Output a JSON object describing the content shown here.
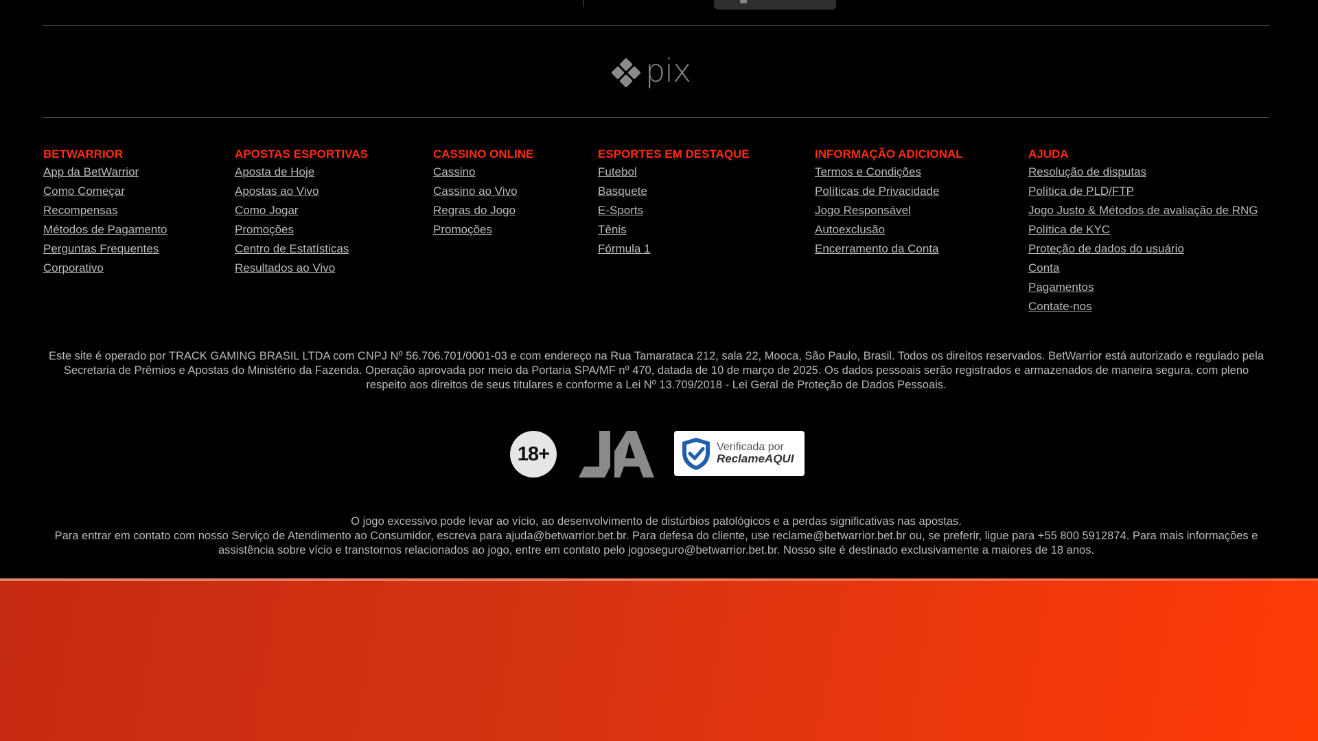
{
  "payment": {
    "pix_label": "pix"
  },
  "footer": {
    "columns": [
      {
        "title": "BETWARRIOR",
        "links": [
          "App da BetWarrior",
          "Como Começar",
          "Recompensas",
          "Métodos de Pagamento",
          "Perguntas Frequentes",
          "Corporativo"
        ]
      },
      {
        "title": "APOSTAS ESPORTIVAS",
        "links": [
          "Aposta de Hoje",
          "Apostas ao Vivo",
          "Como Jogar",
          "Promoções",
          "Centro de Estatísticas",
          "Resultados ao Vivo"
        ]
      },
      {
        "title": "CASSINO ONLINE",
        "links": [
          "Cassino",
          "Cassino ao Vivo",
          "Regras do Jogo",
          "Promoções"
        ]
      },
      {
        "title": "ESPORTES EM DESTAQUE",
        "links": [
          "Futebol",
          "Basquete",
          "E-Sports",
          "Tênis",
          "Fórmula 1"
        ]
      },
      {
        "title": "INFORMAÇÃO ADICIONAL",
        "links": [
          "Termos e Condições",
          "Políticas de Privacidade",
          "Jogo Responsável",
          "Autoexclusão",
          "Encerramento da Conta"
        ]
      },
      {
        "title": "AJUDA",
        "links": [
          "Resolução de disputas",
          "Política de PLD/FTP",
          "Jogo Justo & Métodos de avaliação de RNG",
          "Política de KYC",
          "Proteção de dados do usuário",
          "Conta",
          "Pagamentos",
          "Contate-nos"
        ]
      }
    ],
    "legal_text": "Este site é operado por TRACK GAMING BRASIL LTDA com CNPJ Nº 56.706.701/0001-03 e com endereço na Rua Tamarataca 212, sala 22, Mooca, São Paulo, Brasil. Todos os direitos reservados. BetWarrior está autorizado e regulado pela Secretaria de Prêmios e Apostas do Ministério da Fazenda. Operação aprovada por meio da Portaria SPA/MF nº 470, datada de 10 de março de 2025. Os dados pessoais serão registrados e armazenados de maneira segura, com pleno respeito aos direitos de seus titulares e conforme a Lei Nº 13.709/2018 - Lei Geral de Proteção de Dados Pessoais.",
    "badges": {
      "age": "18+",
      "ja": "JA",
      "reclame_top": "Verificada por",
      "reclame_brand": "ReclameAQUI"
    },
    "disclaimer_line1": "O jogo excessivo pode levar ao vício, ao desenvolvimento de distúrbios patológicos e a perdas significativas nas apostas.",
    "disclaimer_line2": "Para entrar em contato com nosso Serviço de Atendimento ao Consumidor, escreva para ajuda@betwarrior.bet.br. Para defesa do cliente, use reclame@betwarrior.bet.br ou, se preferir, ligue para +55 800 5912874. Para mais informações e assistência sobre vício e transtornos relacionados ao jogo, entre em contato pelo jogoseguro@betwarrior.bet.br. Nosso site é destinado exclusivamente a maiores de 18 anos."
  },
  "colors": {
    "accent": "#ff2b10",
    "link": "#b9b9b9",
    "background": "#000000",
    "band": "#e03a10"
  }
}
